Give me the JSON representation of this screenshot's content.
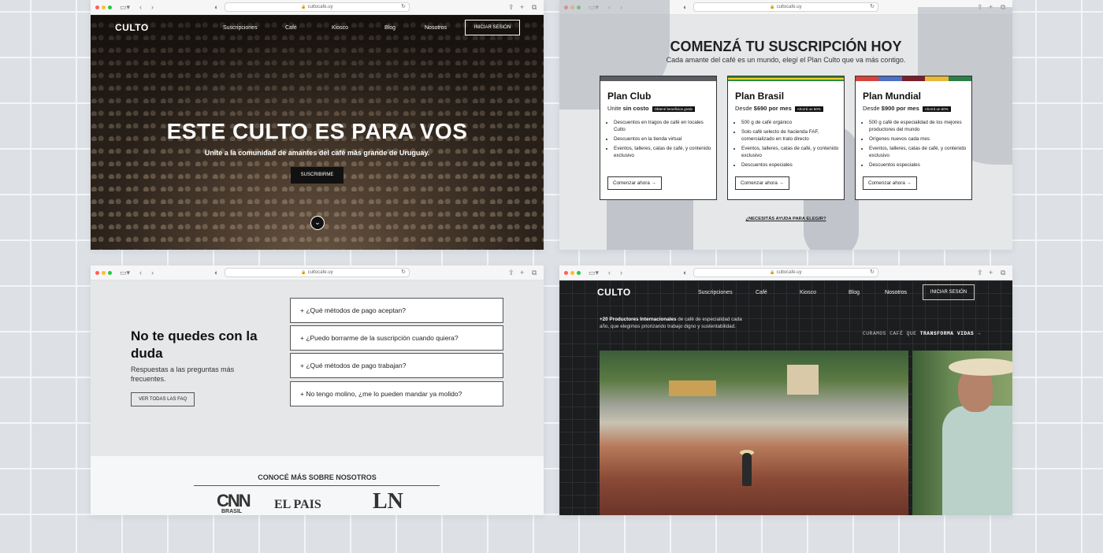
{
  "browser": {
    "url_1": "cultocafe.uy",
    "url_2": "cultocafe.uy",
    "url_3": "cultocafe.uy",
    "url_4": "cultocafe.uy"
  },
  "nav": {
    "logo": "CULTO",
    "items": [
      "Suscripciones",
      "Café",
      "Kiosco",
      "Blog",
      "Nosotros"
    ],
    "login": "INICIAR SESIÓN"
  },
  "hero": {
    "title": "ESTE CULTO ES PARA VOS",
    "subtitle": "Unite a la comunidad de amantes del café más grande de Uruguay.",
    "cta": "SUSCRIBIRME",
    "scroll_icon": "chevron-down-icon"
  },
  "plans": {
    "title": "COMENZÁ TU SUSCRIPCIÓN HOY",
    "subtitle": "Cada amante del café es un mundo, elegí el Plan Culto que va más contigo.",
    "cards": [
      {
        "name": "Plan Club",
        "price_prefix": "Unite",
        "price": "sin costo",
        "price_suffix": "",
        "badge": "Obtené beneficios gratis",
        "features": [
          "Descuentos en tragos de café en locales Culto",
          "Descuentos en la tienda virtual",
          "Eventos, talleres, catas de café, y contenido exclusivo"
        ],
        "cta": "Comenzar ahora",
        "stripe_colors": [
          "#5b5d62",
          "#5b5d62"
        ]
      },
      {
        "name": "Plan Brasil",
        "price_prefix": "Desde",
        "price": "$690",
        "price_suffix": "por mes",
        "badge": "Ahorrá un 50%",
        "features": [
          "500 g de café orgánico",
          "Solo café selecto de hacienda FAF, comercializado en trato directo",
          "Eventos, talleres, catas de café, y contenido exclusivo",
          "Descuentos especiales"
        ],
        "cta": "Comenzar ahora",
        "stripe_colors": [
          "#2f8a3c",
          "#f2d22f",
          "#2f8a3c"
        ]
      },
      {
        "name": "Plan Mundial",
        "price_prefix": "Desde",
        "price": "$900",
        "price_suffix": "por mes",
        "badge": "Ahorrá un 60%",
        "features": [
          "500 g café de especialidad de los mejores productores del mundo",
          "Orígenes nuevos cada mes",
          "Eventos, talleres, catas de café, y contenido exclusivo",
          "Descuentos especiales"
        ],
        "cta": "Comenzar ahora",
        "stripe_colors": [
          "#d8423a",
          "#4d6fc4",
          "#7a1f2a",
          "#e6b93b",
          "#2e7f4a"
        ]
      }
    ],
    "help": "¿NECESITÁS AYUDA PARA ELEGIR?"
  },
  "faq": {
    "title": "No te quedes con la duda",
    "subtitle": "Respuestas a las preguntas más frecuentes.",
    "button": "VER TODAS LAS FAQ",
    "questions": [
      "+ ¿Qué métodos de pago aceptan?",
      "+ ¿Puedo borrarme de la suscripción cuando quiera?",
      "+ ¿Qué métodos de pago trabajan?",
      "+ No tengo molino, ¿me lo pueden mandar ya molido?"
    ],
    "press_title": "CONOCÉ MÁS SOBRE NOSOTROS",
    "press": [
      "CNN",
      "BRASIL",
      "EL PAIS",
      "LN"
    ]
  },
  "producers": {
    "highlight": "+20 Productores Internacionales",
    "text": " de café de especialidad cada año, que elegimos priorizando trabajo digno y sustentabilidad.",
    "cura_prefix": "CURAMOS CAFÉ QUE ",
    "cura_bold": "TRANSFORMA VIDAS",
    "arrow": "→"
  },
  "colors": {
    "dark_bg": "#1c1d1f",
    "page_bg": "#dde1e6",
    "panel_bg": "#e6e7e9"
  }
}
